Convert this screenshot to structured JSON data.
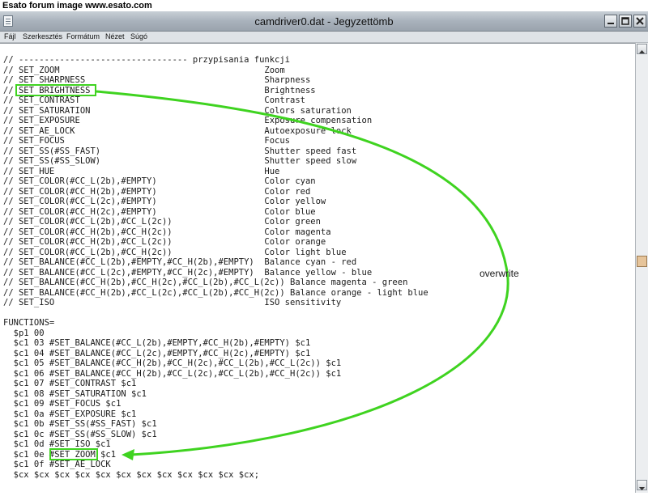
{
  "forum_caption": "Esato forum image www.esato.com",
  "window": {
    "title": "camdriver0.dat - Jegyzettömb",
    "icon": "notepad-icon",
    "controls": [
      "minimize-icon",
      "maximize-icon",
      "close-icon"
    ]
  },
  "menu": {
    "items": [
      "Fájl",
      "Szerkesztés",
      "Formátum",
      "Nézet",
      "Súgó"
    ]
  },
  "editor": {
    "lines": [
      "// --------------------------------- przypisania funkcji",
      "// SET_ZOOM                                        Zoom",
      "// SET_SHARPNESS                                   Sharpness",
      "// SET_BRIGHTNESS                                  Brightness",
      "// SET_CONTRAST                                    Contrast",
      "// SET_SATURATION                                  Colors saturation",
      "// SET_EXPOSURE                                    Exposure compensation",
      "// SET_AE_LOCK                                     Autoexposure lock",
      "// SET_FOCUS                                       Focus",
      "// SET_SS(#SS_FAST)                                Shutter speed fast",
      "// SET_SS(#SS_SLOW)                                Shutter speed slow",
      "// SET_HUE                                         Hue",
      "// SET_COLOR(#CC_L(2b),#EMPTY)                     Color cyan",
      "// SET_COLOR(#CC_H(2b),#EMPTY)                     Color red",
      "// SET_COLOR(#CC_L(2c),#EMPTY)                     Color yellow",
      "// SET_COLOR(#CC_H(2c),#EMPTY)                     Color blue",
      "// SET_COLOR(#CC_L(2b),#CC_L(2c))                  Color green",
      "// SET_COLOR(#CC_H(2b),#CC_H(2c))                  Color magenta",
      "// SET_COLOR(#CC_H(2b),#CC_L(2c))                  Color orange",
      "// SET_COLOR(#CC_L(2b),#CC_H(2c))                  Color light blue",
      "// SET_BALANCE(#CC_L(2b),#EMPTY,#CC_H(2b),#EMPTY)  Balance cyan - red",
      "// SET_BALANCE(#CC_L(2c),#EMPTY,#CC_H(2c),#EMPTY)  Balance yellow - blue",
      "// SET_BALANCE(#CC_H(2b),#CC_H(2c),#CC_L(2b),#CC_L(2c)) Balance magenta - green",
      "// SET_BALANCE(#CC_H(2b),#CC_L(2c),#CC_L(2b),#CC_H(2c)) Balance orange - light blue",
      "// SET_ISO                                         ISO sensitivity",
      "",
      "FUNCTIONS=",
      "  $p1 00",
      "  $c1 03 #SET_BALANCE(#CC_L(2b),#EMPTY,#CC_H(2b),#EMPTY) $c1",
      "  $c1 04 #SET_BALANCE(#CC_L(2c),#EMPTY,#CC_H(2c),#EMPTY) $c1",
      "  $c1 05 #SET_BALANCE(#CC_H(2b),#CC_H(2c),#CC_L(2b),#CC_L(2c)) $c1",
      "  $c1 06 #SET_BALANCE(#CC_H(2b),#CC_L(2c),#CC_L(2b),#CC_H(2c)) $c1",
      "  $c1 07 #SET_CONTRAST $c1",
      "  $c1 08 #SET_SATURATION $c1",
      "  $c1 09 #SET_FOCUS $c1",
      "  $c1 0a #SET_EXPOSURE $c1",
      "  $c1 0b #SET_SS(#SS_FAST) $c1",
      "  $c1 0c #SET_SS(#SS_SLOW) $c1",
      "  $c1 0d #SET_ISO $c1",
      "  $c1 0e #SET_ZOOM $c1",
      "  $c1 0f #SET_AE_LOCK",
      "  $cx $cx $cx $cx $cx $cx $cx $cx $cx $cx $cx $cx;"
    ]
  },
  "annotation": {
    "label": "overwrite",
    "color": "#3fd320"
  }
}
